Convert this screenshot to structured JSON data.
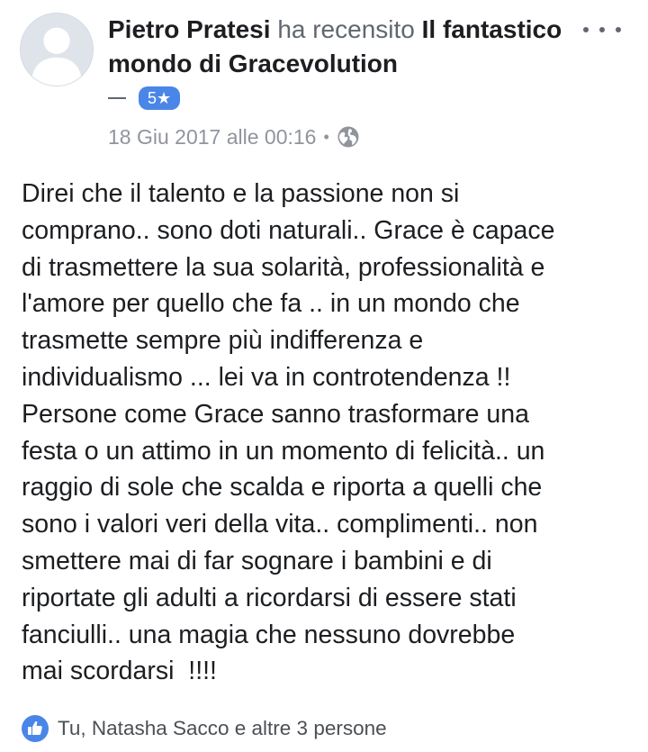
{
  "review": {
    "author": "Pietro Pratesi",
    "verb": "ha recensito",
    "page": "Il fantastico mondo di Gracevolution",
    "rating": "5★",
    "date": "18 Giu 2017 alle 00:16",
    "separator": "•",
    "audience_icon": "globe-icon",
    "text": "Direi che il talento e la passione non si\ncomprano.. sono doti naturali.. Grace è capace\ndi trasmettere la sua solarità, professionalità e\nl'amore per quello che fa .. in un mondo che\ntrasmette sempre più indifferenza e\nindividualismo ... lei va in controtendenza !!\nPersone come Grace sanno trasformare una\nfesta o un attimo in un momento di felicità.. un\nraggio di sole che scalda e riporta a quelli che\nsono i valori veri della vita.. complimenti.. non\nsmettere mai di far sognare i bambini e di\nriportate gli adulti a ricordarsi di essere stati\nfanciulli.. una magia che nessuno dovrebbe\nmai scordarsi  !!!!"
  },
  "reactions": {
    "icon": "like-icon",
    "text": "Tu, Natasha Sacco e altre 3 persone"
  },
  "colors": {
    "accent": "#4a86e8",
    "secondary_text": "#90949c",
    "primary_text": "#1c1e21"
  }
}
